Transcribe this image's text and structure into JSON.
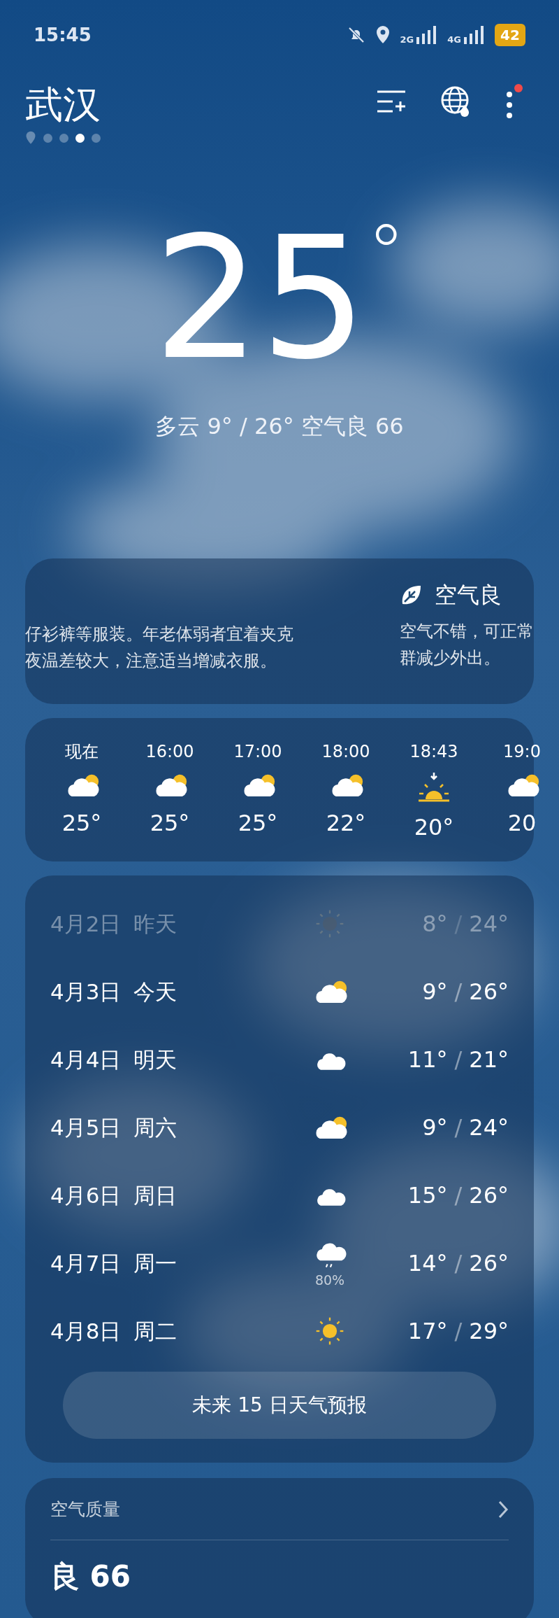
{
  "status_bar": {
    "time": "15:45",
    "net_1": "2G",
    "net_2": "4G",
    "battery": "42"
  },
  "header": {
    "city": "武汉",
    "menu_badge": true,
    "pages": [
      {
        "kind": "location",
        "selected": false
      },
      {
        "kind": "dot",
        "selected": false
      },
      {
        "kind": "dot",
        "selected": false
      },
      {
        "kind": "dot",
        "selected": true
      },
      {
        "kind": "dot",
        "selected": false
      }
    ]
  },
  "current": {
    "temperature": "25",
    "degree": "°",
    "summary": "多云  9° / 26°  空气良 66"
  },
  "tips": {
    "left_lines": [
      "仔衫裤等服装。年老体弱者宜着夹克",
      "夜温差较大，注意适当增减衣服。"
    ],
    "right_title": "空气良",
    "right_lines": [
      "空气不错，可正常",
      "群减少外出。"
    ]
  },
  "hourly": [
    {
      "time": "现在",
      "kind": "partly_cloudy",
      "temp": "25°"
    },
    {
      "time": "16:00",
      "kind": "partly_cloudy",
      "temp": "25°"
    },
    {
      "time": "17:00",
      "kind": "partly_cloudy",
      "temp": "25°"
    },
    {
      "time": "18:00",
      "kind": "partly_cloudy",
      "temp": "22°"
    },
    {
      "time": "18:43",
      "kind": "sunset",
      "temp": "20°"
    },
    {
      "time": "19:0",
      "kind": "partly_cloudy",
      "temp": "20"
    }
  ],
  "daily": [
    {
      "date": "4月2日",
      "day": "昨天",
      "kind": "sunny",
      "low": "8°",
      "sep": "/",
      "high": "24°",
      "past": true
    },
    {
      "date": "4月3日",
      "day": "今天",
      "kind": "partly_cloudy",
      "low": "9°",
      "sep": "/",
      "high": "26°",
      "past": false
    },
    {
      "date": "4月4日",
      "day": "明天",
      "kind": "cloudy",
      "low": "11°",
      "sep": "/",
      "high": "21°",
      "past": false
    },
    {
      "date": "4月5日",
      "day": "周六",
      "kind": "partly_cloudy",
      "low": "9°",
      "sep": "/",
      "high": "24°",
      "past": false
    },
    {
      "date": "4月6日",
      "day": "周日",
      "kind": "cloudy",
      "low": "15°",
      "sep": "/",
      "high": "26°",
      "past": false
    },
    {
      "date": "4月7日",
      "day": "周一",
      "kind": "rain",
      "precip": "80%",
      "low": "14°",
      "sep": "/",
      "high": "26°",
      "past": false
    },
    {
      "date": "4月8日",
      "day": "周二",
      "kind": "sunny",
      "low": "17°",
      "sep": "/",
      "high": "29°",
      "past": false
    }
  ],
  "forecast_button": "未来 15 日天气预报",
  "air_quality": {
    "title": "空气质量",
    "value": "良 66"
  }
}
